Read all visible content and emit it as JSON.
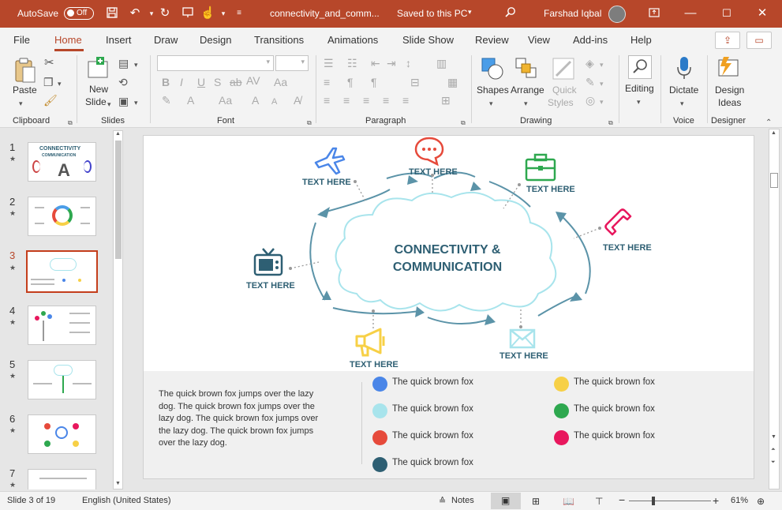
{
  "titlebar": {
    "autosave_label": "AutoSave",
    "autosave_state": "Off",
    "filename": "connectivity_and_comm...",
    "save_status": "Saved to this PC",
    "user": "Farshad Iqbal"
  },
  "menu": {
    "tabs": [
      "File",
      "Home",
      "Insert",
      "Draw",
      "Design",
      "Transitions",
      "Animations",
      "Slide Show",
      "Review",
      "View",
      "Add-ins",
      "Help"
    ],
    "active": "Home"
  },
  "ribbon": {
    "groups": {
      "clipboard": "Clipboard",
      "slides": "Slides",
      "font": "Font",
      "paragraph": "Paragraph",
      "drawing": "Drawing",
      "voice": "Voice",
      "designer": "Designer"
    },
    "buttons": {
      "paste": "Paste",
      "new_slide_1": "New",
      "new_slide_2": "Slide",
      "shapes": "Shapes",
      "arrange": "Arrange",
      "quick_styles_1": "Quick",
      "quick_styles_2": "Styles",
      "editing": "Editing",
      "dictate": "Dictate",
      "design_ideas_1": "Design",
      "design_ideas_2": "Ideas"
    }
  },
  "slides_panel": {
    "numbers": [
      "1",
      "2",
      "3",
      "4",
      "5",
      "6",
      "7"
    ],
    "current_index": 3,
    "thumb1_title_1": "CONNECTIVITY",
    "thumb1_title_2": "COMMUNICATION"
  },
  "slide": {
    "title_line1": "CONNECTIVITY &",
    "title_line2": "COMMUNICATION",
    "labels": [
      "TEXT HERE",
      "TEXT HERE",
      "TEXT HERE",
      "TEXT HERE",
      "TEXT HERE",
      "TEXT HERE",
      "TEXT HERE"
    ],
    "paragraph": "The quick brown fox jumps over the lazy dog. The quick brown fox jumps over the lazy dog. The quick brown fox jumps over the lazy dog. The quick brown fox jumps over the lazy dog.",
    "legend": [
      {
        "text": "The quick brown fox",
        "color": "#4a86e8"
      },
      {
        "text": "The quick brown fox",
        "color": "#a8e4ec"
      },
      {
        "text": "The quick brown fox",
        "color": "#e64a3b"
      },
      {
        "text": "The quick brown fox",
        "color": "#2e5f73"
      },
      {
        "text": "The quick brown fox",
        "color": "#f7d046"
      },
      {
        "text": "The quick brown fox",
        "color": "#2ea84f"
      },
      {
        "text": "The quick brown fox",
        "color": "#e8175d"
      }
    ]
  },
  "status": {
    "slide_info": "Slide 3 of 19",
    "language": "English (United States)",
    "notes": "Notes",
    "zoom": "61%"
  },
  "colors": {
    "accent": "#b7472a",
    "title_text": "#2e5f73",
    "cloud": "#a8e4ec",
    "arrow": "#5b93a8"
  }
}
